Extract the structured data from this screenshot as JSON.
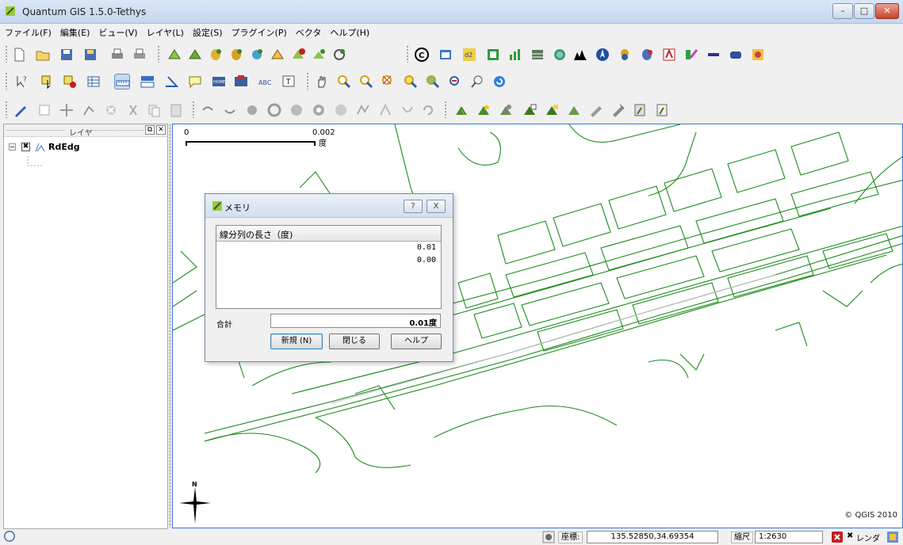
{
  "window": {
    "title": "Quantum GIS 1.5.0-Tethys",
    "controls": {
      "minimize": "–",
      "maximize": "□",
      "close": "✕"
    }
  },
  "menu": [
    "ファイル(F)",
    "編集(E)",
    "ビュー(V)",
    "レイヤ(L)",
    "設定(S)",
    "プラグイン(P)",
    "ベクタ",
    "ヘルプ(H)"
  ],
  "layers_panel": {
    "title": "レイヤ",
    "layers": [
      {
        "name": "RdEdg",
        "visible": true,
        "expanded": true
      }
    ]
  },
  "map": {
    "scale_left": "0",
    "scale_right": "0.002",
    "scale_unit": "度",
    "north": "N",
    "copyright": "© QGIS 2010"
  },
  "dialog": {
    "title": "メモリ",
    "help_btn": "?",
    "close_btn": "X",
    "column_header": "線分列の長さ（度)",
    "rows": [
      "0.01",
      "0.00"
    ],
    "total_label": "合計",
    "total_value": "0.01度",
    "buttons": {
      "new": "新規 (N)",
      "close": "閉じる",
      "help": "ヘルプ"
    }
  },
  "status": {
    "coord_label": "座標:",
    "coord_value": "135.52850,34.69354",
    "scale_label": "縮尺",
    "scale_value": "1:2630",
    "render_label": "レンダ"
  },
  "colors": {
    "road": "#1b8a1b",
    "line_measure": "#c0c0c0",
    "accent": "#3875d7"
  }
}
